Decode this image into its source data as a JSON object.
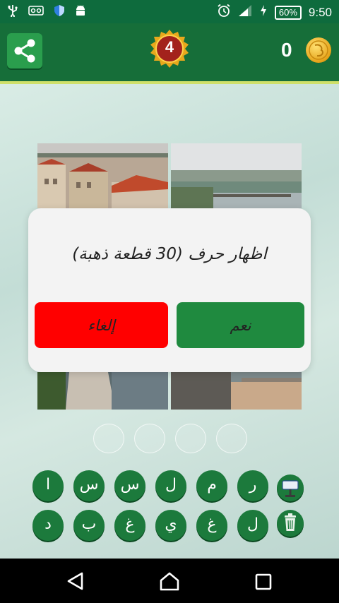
{
  "status_bar": {
    "time": "9:50",
    "battery_percent": "60%",
    "left_icons": [
      "usb-icon",
      "voicemail-icon",
      "shield-icon",
      "android-icon"
    ],
    "right_icons": [
      "alarm-icon",
      "signal-icon",
      "charging-icon",
      "battery-icon"
    ]
  },
  "header": {
    "level": "4",
    "coins": "0",
    "share_icon": "share-icon",
    "coin_icon": "gold-coin-icon"
  },
  "puzzle": {
    "photos": [
      {
        "name": "photo-top-left-city-rooftops"
      },
      {
        "name": "photo-top-right-river-bridges"
      },
      {
        "name": "photo-bottom-left-bridge-crowd"
      },
      {
        "name": "photo-bottom-right-river-embankment"
      }
    ],
    "answer_slots": 4
  },
  "dialog": {
    "message": "اظهار حرف (30 قطعة ذهبة)",
    "yes_label": "نعم",
    "cancel_label": "إلغاء",
    "yes_color": "#1f8a3f",
    "cancel_color": "#ff0000"
  },
  "keyboard": {
    "row1": [
      "ا",
      "س",
      "س",
      "ل",
      "م",
      "ر"
    ],
    "row2": [
      "د",
      "ب",
      "غ",
      "ي",
      "غ",
      "ل"
    ],
    "helper_icons": [
      "hint-help-icon",
      "trash-icon"
    ]
  },
  "navigation": {
    "buttons": [
      "back-icon",
      "home-icon",
      "recents-icon"
    ]
  },
  "colors": {
    "status_bar": "#0e6b3d",
    "top_bar": "#166e39",
    "accent_line": "#cfe06a",
    "key_green": "#1c7a3c"
  }
}
